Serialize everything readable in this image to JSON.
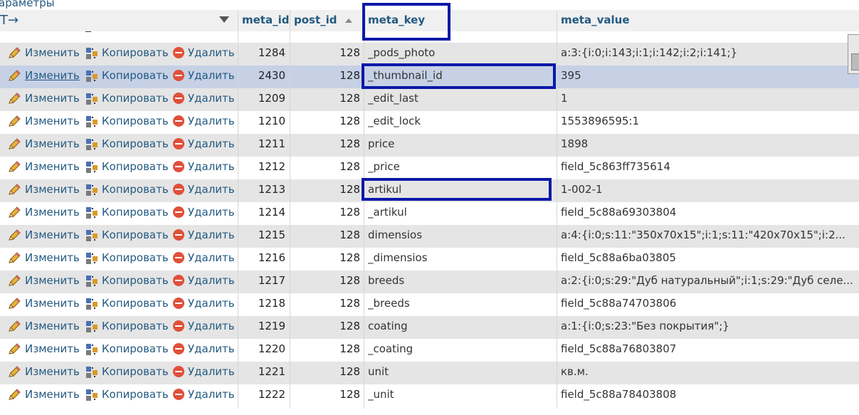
{
  "options_label": "араметры",
  "arrows": "T→",
  "columns": {
    "meta_id": "meta_id",
    "post_id": "post_id",
    "meta_key": "meta_key",
    "meta_value": "meta_value"
  },
  "actions": {
    "edit": "Изменить",
    "copy": "Копировать",
    "delete": "Удалить"
  },
  "colors": {
    "link": "#235a81",
    "highlight_box": "#0a19a8",
    "row_alt": "#e5e5e5",
    "row_selected": "#c6d1e6"
  },
  "rows": [
    {
      "meta_id": "1284",
      "post_id": "128",
      "meta_key": "_pods_photo",
      "meta_value": "a:3:{i:0;i:143;i:1;i:142;i:2;i:141;}"
    },
    {
      "meta_id": "2430",
      "post_id": "128",
      "meta_key": "_thumbnail_id",
      "meta_value": "395"
    },
    {
      "meta_id": "1209",
      "post_id": "128",
      "meta_key": "_edit_last",
      "meta_value": "1"
    },
    {
      "meta_id": "1210",
      "post_id": "128",
      "meta_key": "_edit_lock",
      "meta_value": "1553896595:1"
    },
    {
      "meta_id": "1211",
      "post_id": "128",
      "meta_key": "price",
      "meta_value": "1898"
    },
    {
      "meta_id": "1212",
      "post_id": "128",
      "meta_key": "_price",
      "meta_value": "field_5c863ff735614"
    },
    {
      "meta_id": "1213",
      "post_id": "128",
      "meta_key": "artikul",
      "meta_value": "1-002-1"
    },
    {
      "meta_id": "1214",
      "post_id": "128",
      "meta_key": "_artikul",
      "meta_value": "field_5c88a69303804"
    },
    {
      "meta_id": "1215",
      "post_id": "128",
      "meta_key": "dimensios",
      "meta_value": "a:4:{i:0;s:11:\"350x70x15\";i:1;s:11:\"420x70x15\";i:2..."
    },
    {
      "meta_id": "1216",
      "post_id": "128",
      "meta_key": "_dimensios",
      "meta_value": "field_5c88a6ba03805"
    },
    {
      "meta_id": "1217",
      "post_id": "128",
      "meta_key": "breeds",
      "meta_value": "a:2:{i:0;s:29:\"Дуб натуральный\";i:1;s:29:\"Дуб селе..."
    },
    {
      "meta_id": "1218",
      "post_id": "128",
      "meta_key": "_breeds",
      "meta_value": "field_5c88a74703806"
    },
    {
      "meta_id": "1219",
      "post_id": "128",
      "meta_key": "coating",
      "meta_value": "a:1:{i:0;s:23:\"Без покрытия\";}"
    },
    {
      "meta_id": "1220",
      "post_id": "128",
      "meta_key": "_coating",
      "meta_value": "field_5c88a76803807"
    },
    {
      "meta_id": "1221",
      "post_id": "128",
      "meta_key": "unit",
      "meta_value": "кв.м."
    },
    {
      "meta_id": "1222",
      "post_id": "128",
      "meta_key": "_unit",
      "meta_value": "field_5c88a78403808"
    }
  ]
}
